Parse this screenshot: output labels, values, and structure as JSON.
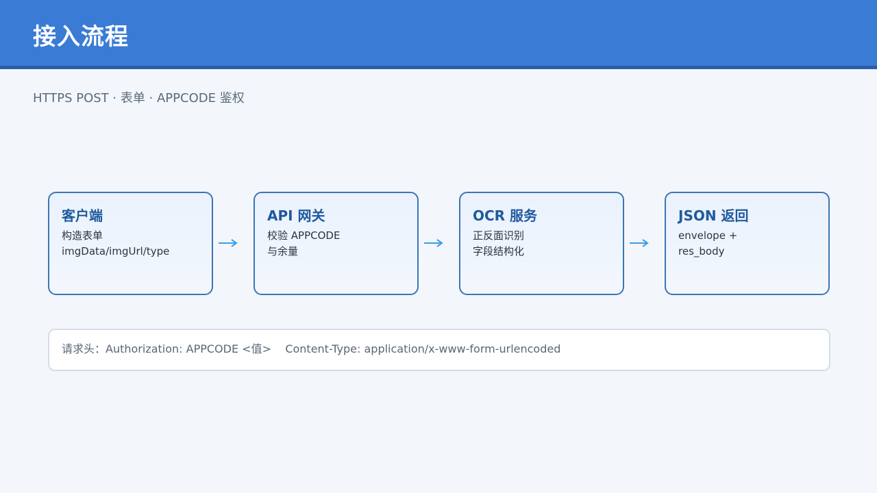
{
  "header": {
    "title": "接入流程"
  },
  "subtitle": "HTTPS POST · 表单 · APPCODE 鉴权",
  "flow": {
    "steps": [
      {
        "title": "客户端",
        "lines": [
          "构造表单",
          "imgData/imgUrl/type"
        ]
      },
      {
        "title": "API 网关",
        "lines": [
          "校验 APPCODE",
          "与余量"
        ]
      },
      {
        "title": "OCR 服务",
        "lines": [
          "正反面识别",
          "字段结构化"
        ]
      },
      {
        "title": "JSON 返回",
        "lines": [
          "envelope +",
          "res_body"
        ]
      }
    ],
    "arrow_icon": "right-arrow-icon"
  },
  "note": {
    "text": "请求头：Authorization: APPCODE <值>    Content-Type: application/x-www-form-urlencoded"
  },
  "colors": {
    "header_bg": "#3a7bd5",
    "accent": "#1f5a9e",
    "card_border": "#3d74b4",
    "arrow": "#3a9ee8"
  }
}
